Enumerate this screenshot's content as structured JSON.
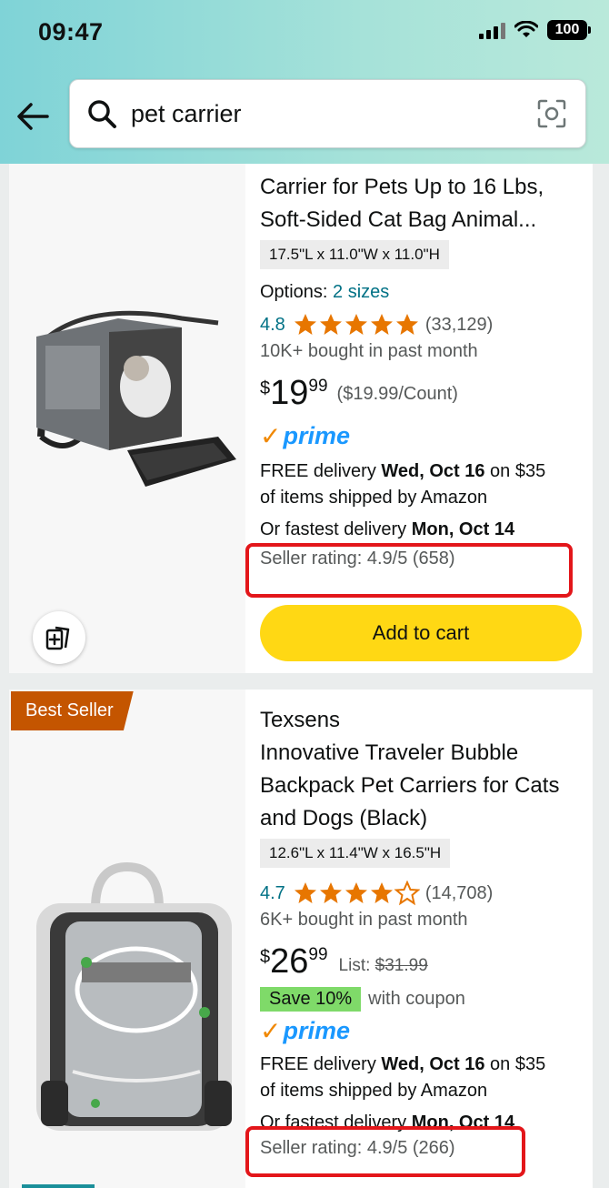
{
  "status": {
    "time": "09:47",
    "battery": "100"
  },
  "search": {
    "query": "pet carrier"
  },
  "products": [
    {
      "title_partial": [
        "Carrier for Pets Up to 16 Lbs,",
        "Soft-Sided Cat Bag Animal..."
      ],
      "dimensions": "17.5\"L x 11.0\"W x 11.0\"H",
      "options_label": "Options:",
      "options_link": "2 sizes",
      "rating": "4.8",
      "stars": 5,
      "rating_count": "(33,129)",
      "bought": "10K+ bought in past month",
      "price_symbol": "$",
      "price_whole": "19",
      "price_fraction": "99",
      "unit_price": "($19.99/Count)",
      "prime": "prime",
      "delivery_prefix": "FREE delivery ",
      "delivery_date": "Wed, Oct 16",
      "delivery_suffix": " on $35",
      "delivery_line2": "of items shipped by Amazon",
      "fastest_prefix": "Or fastest delivery ",
      "fastest_date": "Mon, Oct 14",
      "seller_rating": "Seller rating: 4.9/5 (658)",
      "add_to_cart": "Add to cart"
    },
    {
      "badge": "Best Seller",
      "brand": "Texsens",
      "title": [
        "Innovative Traveler Bubble",
        "Backpack Pet Carriers for Cats",
        "and Dogs (Black)"
      ],
      "dimensions": "12.6\"L x 11.4\"W x 16.5\"H",
      "rating": "4.7",
      "stars": 4.5,
      "rating_count": "(14,708)",
      "bought": "6K+ bought in past month",
      "price_symbol": "$",
      "price_whole": "26",
      "price_fraction": "99",
      "list_label": "List: ",
      "list_price": "$31.99",
      "coupon_badge": "Save 10%",
      "coupon_text": "with coupon",
      "prime": "prime",
      "delivery_prefix": "FREE delivery ",
      "delivery_date": "Wed, Oct 16",
      "delivery_suffix": " on $35",
      "delivery_line2": "of items shipped by Amazon",
      "fastest_prefix": "Or fastest delivery ",
      "fastest_date": "Mon, Oct 14",
      "seller_rating": "Seller rating: 4.9/5 (266)"
    }
  ],
  "colors": {
    "star": "#e77600",
    "link": "#007185",
    "cart": "#ffd814",
    "highlight": "#e3161a",
    "badge": "#c45500"
  }
}
